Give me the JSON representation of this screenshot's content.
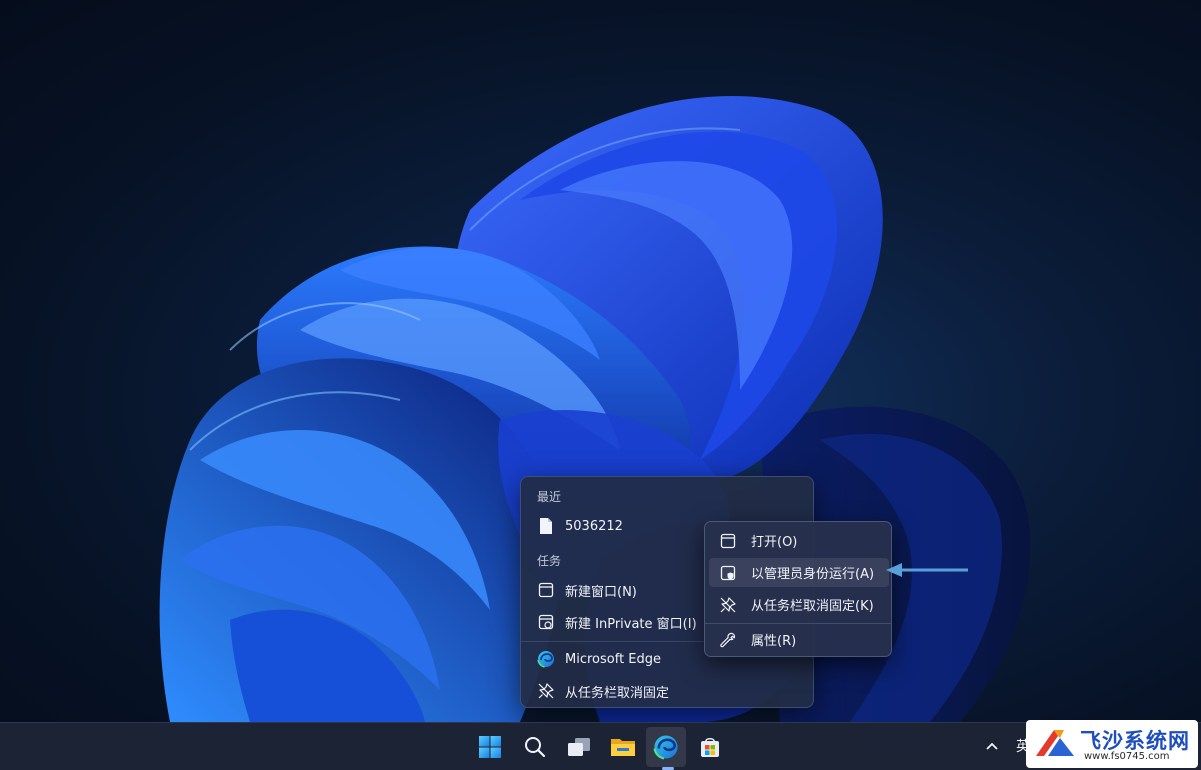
{
  "jumplist": {
    "recent_header": "最近",
    "recent_items": [
      {
        "label": "5036212"
      }
    ],
    "tasks_header": "任务",
    "tasks": [
      {
        "label": "新建窗口(N)"
      },
      {
        "label": "新建 InPrivate 窗口(I)"
      }
    ],
    "app_label": "Microsoft Edge",
    "unpin_label": "从任务栏取消固定"
  },
  "context_menu": {
    "items": [
      {
        "label": "打开(O)",
        "icon": "window-icon"
      },
      {
        "label": "以管理员身份运行(A)",
        "icon": "admin-shield-icon",
        "highlighted": true
      },
      {
        "label": "从任务栏取消固定(K)",
        "icon": "unpin-icon"
      },
      {
        "label": "属性(R)",
        "icon": "wrench-icon"
      }
    ]
  },
  "taskbar": {
    "apps": [
      "start-icon",
      "search-icon",
      "task-view-icon",
      "file-explorer-icon",
      "edge-icon",
      "store-icon"
    ],
    "active_app": "edge-icon",
    "tray_language": "英"
  },
  "watermark": {
    "title": "飞沙系统网",
    "url": "www.fs0745.com"
  },
  "colors": {
    "accent": "#5aa0d8",
    "menu_bg": "#262f4c",
    "taskbar_bg": "#1c2334"
  }
}
